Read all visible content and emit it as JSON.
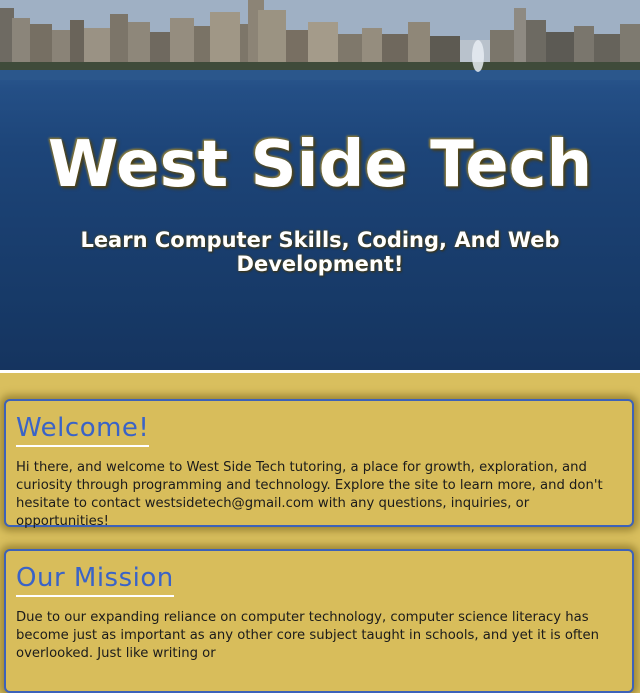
{
  "hero": {
    "title": "West Side Tech",
    "subtitle": "Learn Computer Skills, Coding, And Web Development!"
  },
  "sections": {
    "welcome": {
      "heading": "Welcome!",
      "body": "Hi there, and welcome to West Side Tech tutoring, a place for growth, exploration, and curiosity through programming and technology. Explore the site to learn more, and don't hesitate to contact westsidetech@gmail.com with any questions, inquiries, or opportunities!"
    },
    "mission": {
      "heading": "Our Mission",
      "body": "Due to our expanding reliance on computer technology, computer science literacy has become just as important as any other core subject taught in schools, and yet it is often overlooked. Just like writing or"
    }
  },
  "colors": {
    "page_background": "#d9bf5e",
    "card_border": "#3d62b8",
    "heading_text": "#3a63c7",
    "water": "#1d4579"
  }
}
